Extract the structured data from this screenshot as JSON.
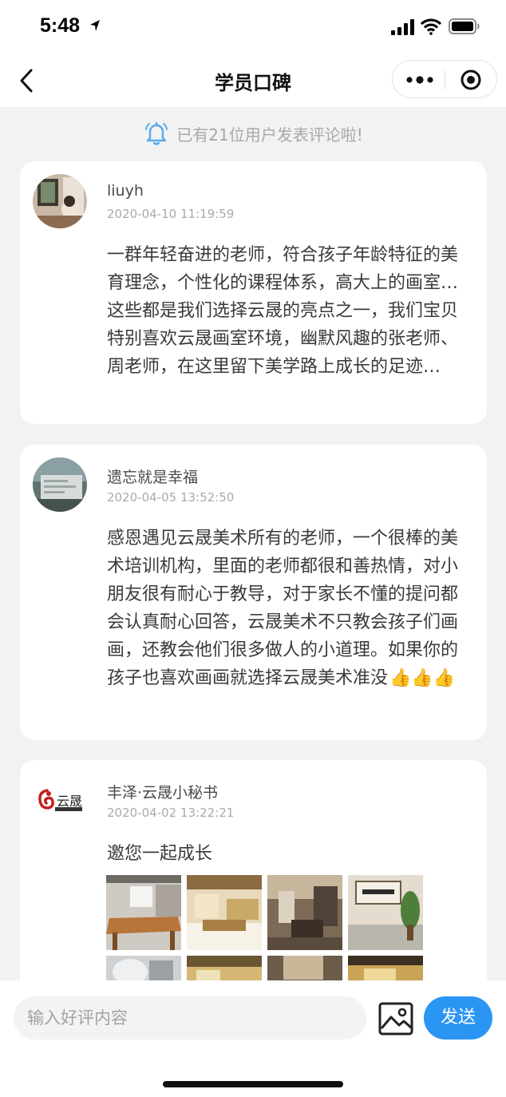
{
  "status_bar": {
    "time": "5:48"
  },
  "nav": {
    "title": "学员口碑"
  },
  "notice": {
    "text": "已有21位用户发表评论啦!"
  },
  "reviews": [
    {
      "user": "liuyh",
      "time": "2020-04-10 11:19:59",
      "text": "一群年轻奋进的老师，符合孩子年龄特征的美育理念，个性化的课程体系，高大上的画室…这些都是我们选择云晟的亮点之一，我们宝贝特别喜欢云晟画室环境，幽默风趣的张老师、周老师，在这里留下美学路上成长的足迹…"
    },
    {
      "user": "遗忘就是幸福",
      "time": "2020-04-05 13:52:50",
      "text": "感恩遇见云晟美术所有的老师，一个很棒的美术培训机构，里面的老师都很和善热情，对小朋友很有耐心于教导，对于家长不懂的提问都会认真耐心回答，云晟美术不只教会孩子们画画，还教会他们很多做人的小道理。如果你的孩子也喜欢画画就选择云晟美术准没",
      "emoji": "👍👍👍"
    },
    {
      "user": "丰泽·云晟小秘书",
      "time": "2020-04-02 13:22:21",
      "text": "邀您一起成长",
      "logo_text": "云晟"
    }
  ],
  "composer": {
    "placeholder": "输入好评内容",
    "send_label": "发送"
  },
  "colors": {
    "accent": "#2b95f3",
    "page_bg": "#f2f2f2",
    "card_bg": "#ffffff"
  }
}
